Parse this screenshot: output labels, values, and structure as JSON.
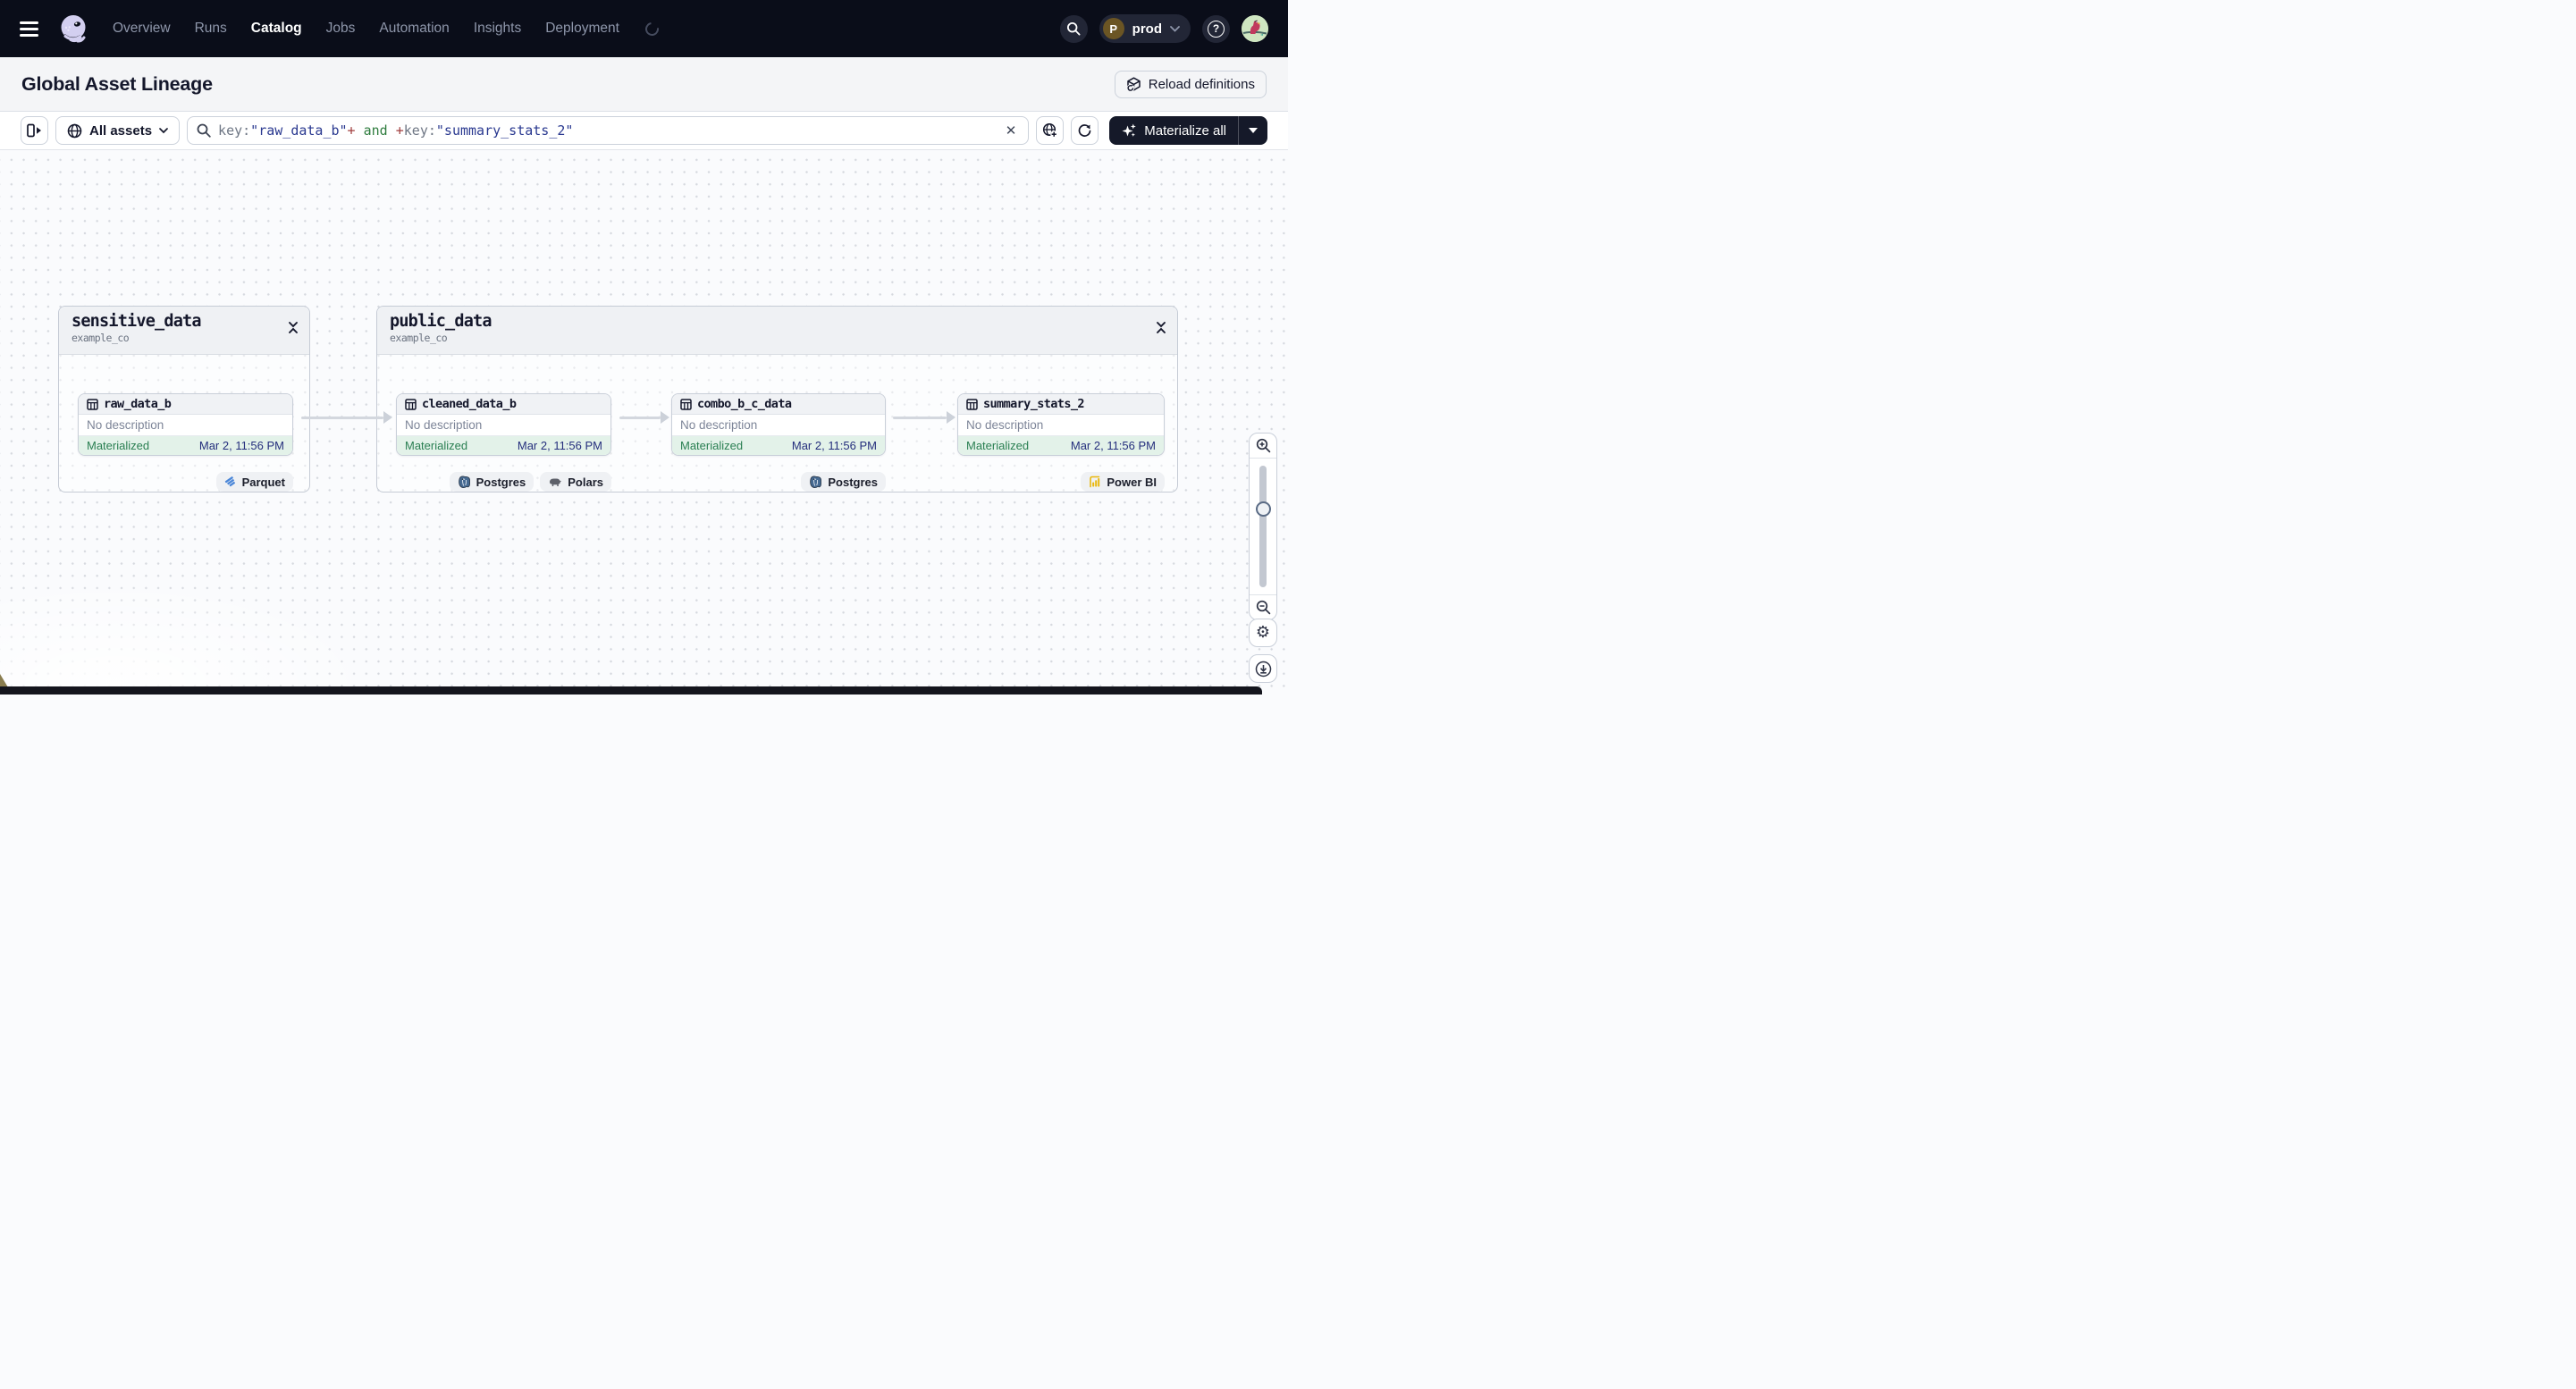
{
  "navbar": {
    "items": [
      "Overview",
      "Runs",
      "Catalog",
      "Jobs",
      "Automation",
      "Insights",
      "Deployment"
    ],
    "active_item": "Catalog",
    "environment": {
      "initial": "P",
      "name": "prod"
    }
  },
  "header": {
    "title": "Global Asset Lineage",
    "reload_button_label": "Reload definitions"
  },
  "toolbar": {
    "scope_button_label": "All assets",
    "search": {
      "tokens": [
        {
          "text": "key:",
          "color": "#6e7684"
        },
        {
          "text": "\"raw_data_b\"",
          "color": "#2a3990"
        },
        {
          "text": "+",
          "color": "#a03d3d"
        },
        {
          "text": " and ",
          "color": "#2f7d3f"
        },
        {
          "text": "+",
          "color": "#a03d3d"
        },
        {
          "text": "key:",
          "color": "#6e7684"
        },
        {
          "text": "\"summary_stats_2\"",
          "color": "#2a3990"
        }
      ]
    },
    "materialize_button_label": "Materialize all"
  },
  "graph": {
    "groups": [
      {
        "name": "sensitive_data",
        "location": "example_co"
      },
      {
        "name": "public_data",
        "location": "example_co"
      }
    ],
    "assets": [
      {
        "name": "raw_data_b",
        "description": "No description",
        "status": "Materialized",
        "materialized_at": "Mar 2, 11:56 PM",
        "tags": [
          "Parquet"
        ]
      },
      {
        "name": "cleaned_data_b",
        "description": "No description",
        "status": "Materialized",
        "materialized_at": "Mar 2, 11:56 PM",
        "tags": [
          "Postgres",
          "Polars"
        ]
      },
      {
        "name": "combo_b_c_data",
        "description": "No description",
        "status": "Materialized",
        "materialized_at": "Mar 2, 11:56 PM",
        "tags": [
          "Postgres"
        ]
      },
      {
        "name": "summary_stats_2",
        "description": "No description",
        "status": "Materialized",
        "materialized_at": "Mar 2, 11:56 PM",
        "tags": [
          "Power BI"
        ]
      }
    ],
    "colors": {
      "status_text": "#2a7f52",
      "status_background": "#e3f2e9",
      "timestamp_text": "#252f7d",
      "edge": "#d3d7de",
      "navbar_background": "#0a0d19",
      "primary_button_background": "#151929"
    }
  }
}
